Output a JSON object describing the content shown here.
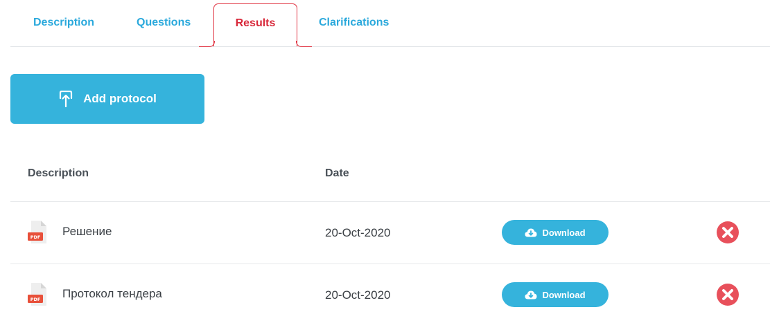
{
  "tabs": [
    {
      "label": "Description",
      "active": false
    },
    {
      "label": "Questions",
      "active": false
    },
    {
      "label": "Results",
      "active": true
    },
    {
      "label": "Clarifications",
      "active": false
    }
  ],
  "add_protocol": {
    "label": "Add protocol",
    "icon": "upload-icon"
  },
  "table": {
    "headers": {
      "description": "Description",
      "date": "Date"
    },
    "rows": [
      {
        "name": "Решение",
        "date": "20-Oct-2020",
        "file_type": "PDF",
        "download_label": "Download"
      },
      {
        "name": "Протокол тендера",
        "date": "20-Oct-2020",
        "file_type": "PDF",
        "download_label": "Download"
      }
    ]
  },
  "colors": {
    "accent": "#35b3dc",
    "tab_text": "#2ba9dc",
    "active_tab": "#d8283a",
    "delete": "#e8505b",
    "pdf_badge": "#e8503a"
  }
}
